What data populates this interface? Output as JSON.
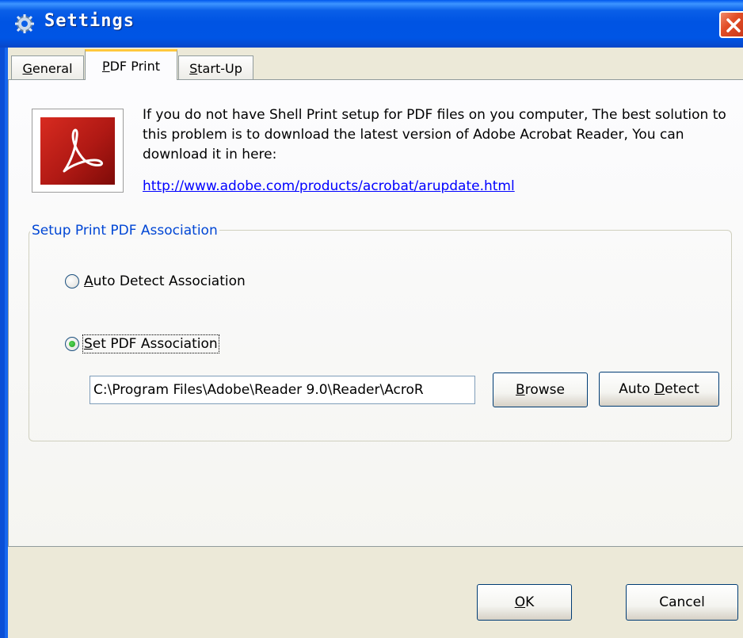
{
  "window": {
    "title": "Settings",
    "icon": "settings-app-icon",
    "close_icon": "close-icon"
  },
  "tabs": [
    {
      "label_pre": "",
      "label_key": "G",
      "label_post": "eneral",
      "active": false
    },
    {
      "label_pre": "",
      "label_key": "P",
      "label_post": "DF Print",
      "active": true
    },
    {
      "label_pre": "",
      "label_key": "S",
      "label_post": "tart-Up",
      "active": false
    }
  ],
  "pdf_print": {
    "logo": "adobe-pdf-logo",
    "intro_text": "If you do not have Shell Print setup for PDF files on you computer, The best solution to this problem is to download the latest version of Adobe Acrobat Reader, You can download it in here:",
    "download_link": "http://www.adobe.com/products/acrobat/arupdate.html",
    "group_label": "Setup Print PDF Association",
    "radio_auto": {
      "key": "A",
      "rest": "uto Detect Association",
      "checked": false
    },
    "radio_set": {
      "key": "S",
      "rest": "et PDF Association",
      "checked": true
    },
    "path_value": "C:\\Program Files\\Adobe\\Reader 9.0\\Reader\\AcroR",
    "browse_button": {
      "key": "B",
      "rest": "rowse"
    },
    "auto_detect_button": {
      "pre": "Auto ",
      "key": "D",
      "rest": "etect"
    }
  },
  "footer": {
    "ok_button": {
      "key": "O",
      "rest": "K"
    },
    "cancel_button": "Cancel"
  },
  "colors": {
    "titlebar": "#0054e3",
    "face": "#ece9d8",
    "link": "#0000ff",
    "group_label": "#0046d5",
    "tab_highlight": "#ffc83c"
  }
}
